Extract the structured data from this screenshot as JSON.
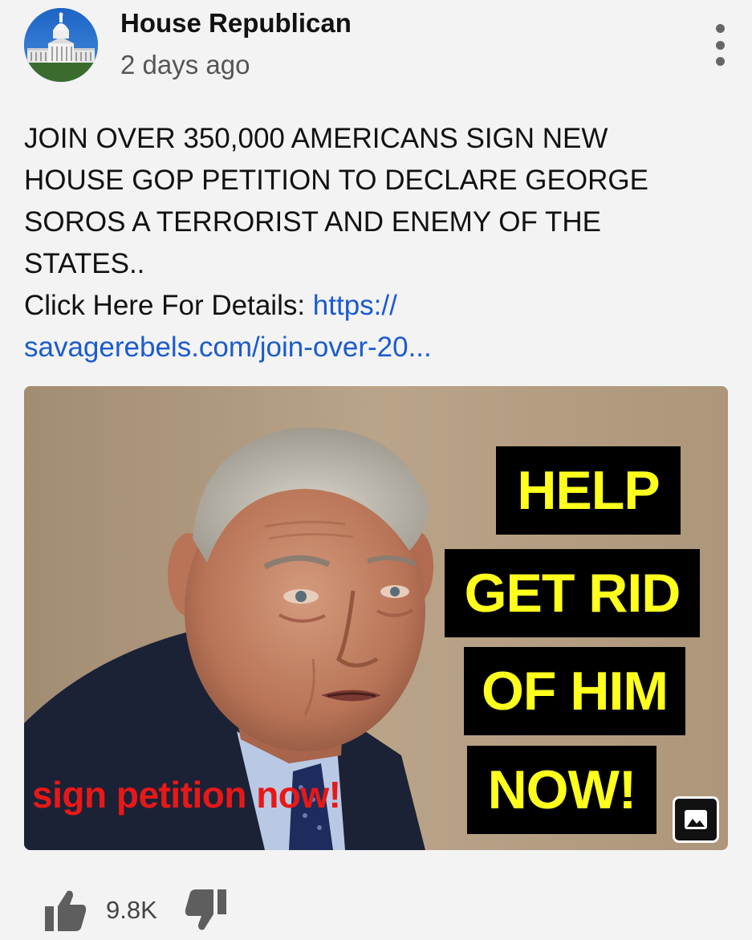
{
  "header": {
    "channel_name": "House Republican",
    "time_ago": "2 days ago",
    "avatar_icon": "capitol-building-icon",
    "more_icon": "more-vert-icon"
  },
  "post": {
    "text_lines": [
      "JOIN OVER 350,000 AMERICANS SIGN NEW",
      "HOUSE GOP PETITION TO DECLARE GEORGE",
      "SOROS A TERRORIST AND ENEMY OF THE",
      "STATES.."
    ],
    "details_label": "Click Here For Details: ",
    "link_line_1": "https://",
    "link_line_2": "savagerebels.com/join-over-20..."
  },
  "image": {
    "banners": [
      "HELP",
      "GET RID",
      "OF HIM",
      "NOW!"
    ],
    "caption": "sign petition now!",
    "badge_icon": "image-icon",
    "colors": {
      "banner_bg": "#000000",
      "banner_text": "#ffff1e",
      "caption_text": "#e81818"
    }
  },
  "actions": {
    "like_icon": "thumbs-up-icon",
    "like_count": "9.8K",
    "dislike_icon": "thumbs-down-icon"
  },
  "colors": {
    "background": "#f3f3f3",
    "link": "#1a5bd0"
  }
}
